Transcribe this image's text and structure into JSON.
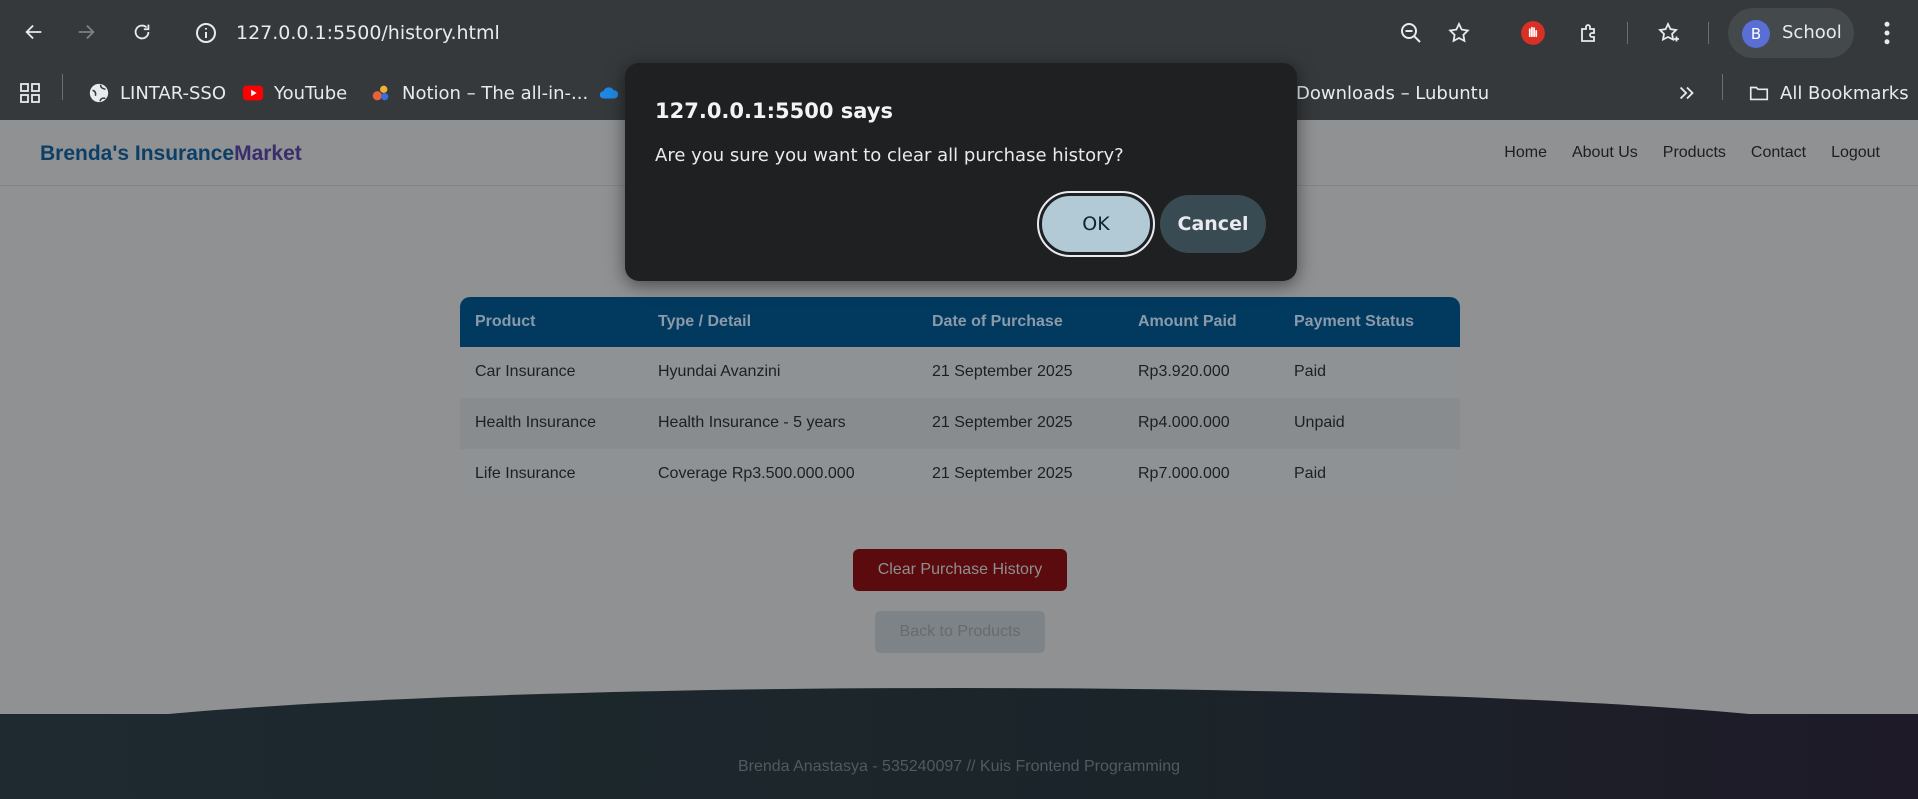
{
  "browser": {
    "url": "127.0.0.1:5500/history.html",
    "profile_initial": "B",
    "profile_name": "School",
    "bookmarks": [
      {
        "label": "LINTAR-SSO",
        "icon": "globe-icon"
      },
      {
        "label": "YouTube",
        "icon": "youtube-icon"
      },
      {
        "label": "Notion – The all-in-...",
        "icon": "notion-icon"
      },
      {
        "label": "",
        "icon": "onedrive-icon"
      },
      {
        "label": "Downloads – Lubuntu",
        "icon": ""
      }
    ],
    "all_bookmarks": "All Bookmarks"
  },
  "site": {
    "brand_part1": "Brenda's Insurance",
    "brand_part2": "Market",
    "nav": [
      "Home",
      "About Us",
      "Products",
      "Contact",
      "Logout"
    ]
  },
  "history_table": {
    "headers": [
      "Product",
      "Type / Detail",
      "Date of Purchase",
      "Amount Paid",
      "Payment Status"
    ],
    "rows": [
      [
        "Car Insurance",
        "Hyundai Avanzini",
        "21 September 2025",
        "Rp3.920.000",
        "Paid"
      ],
      [
        "Health Insurance",
        "Health Insurance - 5 years",
        "21 September 2025",
        "Rp4.000.000",
        "Unpaid"
      ],
      [
        "Life Insurance",
        "Coverage Rp3.500.000.000",
        "21 September 2025",
        "Rp7.000.000",
        "Paid"
      ]
    ]
  },
  "buttons": {
    "clear": "Clear Purchase History",
    "back": "Back to Products"
  },
  "footer": {
    "text": "Brenda Anastasya - 535240097 // Kuis Frontend Programming"
  },
  "dialog": {
    "title": "127.0.0.1:5500 says",
    "message": "Are you sure you want to clear all purchase history?",
    "ok": "OK",
    "cancel": "Cancel"
  },
  "colors": {
    "chrome_bg": "#35393b",
    "dialog_bg": "#1f2021",
    "ok_button": "#b2c9d6",
    "cancel_button": "#384a52",
    "table_header": "#023a5f",
    "clear_button": "#5b0a0d"
  }
}
